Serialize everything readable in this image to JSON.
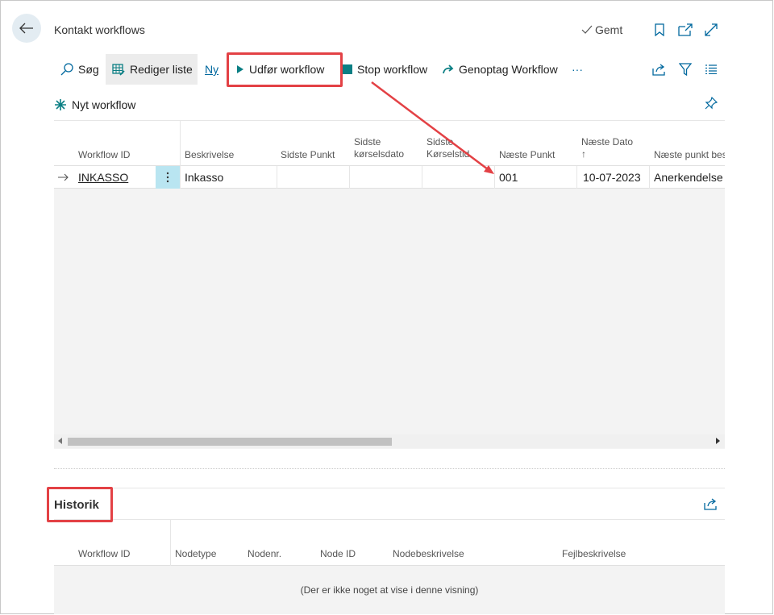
{
  "header": {
    "title": "Kontakt workflows",
    "saved_label": "Gemt"
  },
  "actions": {
    "search": "Søg",
    "edit_list": "Rediger liste",
    "new": "Ny",
    "run_workflow": "Udfør workflow",
    "stop_workflow": "Stop workflow",
    "resume_workflow": "Genoptag Workflow",
    "more": "···"
  },
  "subactions": {
    "new_workflow": "Nyt workflow"
  },
  "grid": {
    "columns": {
      "workflow_id": "Workflow ID",
      "description": "Beskrivelse",
      "last_point": "Sidste Punkt",
      "last_run_date_1": "Sidste",
      "last_run_date_2": "kørselsdato",
      "last_run_time_1": "Sidste",
      "last_run_time_2": "Kørselstid",
      "next_point": "Næste Punkt",
      "next_date": "Næste Dato",
      "next_date_sort": "↑",
      "next_point_desc": "Næste punkt bes"
    },
    "rows": [
      {
        "workflow_id": "INKASSO",
        "description": "Inkasso",
        "last_point": "",
        "last_run_date": "",
        "last_run_time": "",
        "next_point": "001",
        "next_date": "10-07-2023",
        "next_point_desc": "Anerkendelse"
      }
    ]
  },
  "history": {
    "title": "Historik",
    "columns": {
      "workflow_id": "Workflow ID",
      "node_type": "Nodetype",
      "node_no": "Nodenr.",
      "node_id": "Node ID",
      "node_desc": "Nodebeskrivelse",
      "error_desc": "Fejlbeskrivelse"
    },
    "empty_text": "(Der er ikke noget at vise i denne visning)"
  },
  "colors": {
    "annotation": "#e34145",
    "accent": "#00689e",
    "teal": "#0b7f84"
  }
}
